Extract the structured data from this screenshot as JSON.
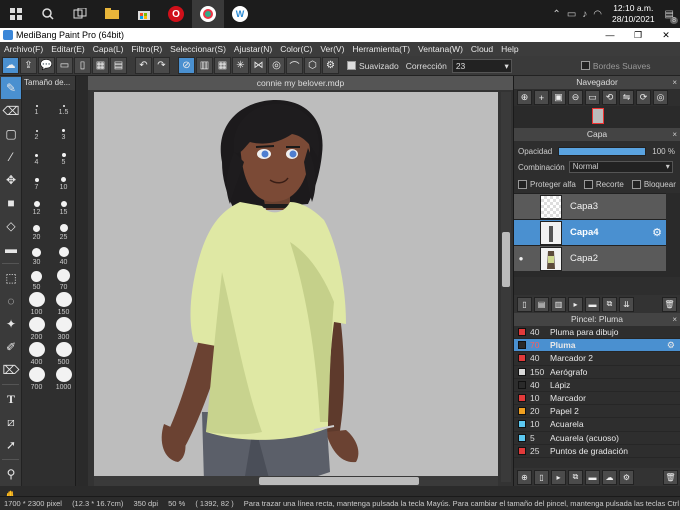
{
  "taskbar": {
    "apps": [
      {
        "icon": "windows-icon"
      },
      {
        "icon": "search-icon"
      },
      {
        "icon": "task-view-icon"
      },
      {
        "icon": "file-explorer-icon"
      },
      {
        "icon": "store-icon"
      },
      {
        "icon": "opera-icon"
      },
      {
        "icon": "medibang-icon"
      },
      {
        "icon": "webex-icon"
      }
    ],
    "time": "12:10 a.m.",
    "date": "28/10/2021",
    "notifications": "8"
  },
  "window": {
    "title": "MediBang Paint Pro (64bit)"
  },
  "menu": [
    "Archivo(F)",
    "Editar(E)",
    "Capa(L)",
    "Filtro(R)",
    "Seleccionar(S)",
    "Ajustar(N)",
    "Color(C)",
    "Ver(V)",
    "Herramienta(T)",
    "Ventana(W)",
    "Cloud",
    "Help"
  ],
  "toolbar": {
    "antialias_label": "Suavizado",
    "correction_label": "Corrección",
    "correction_value": "23",
    "soft_edges_label": "Bordes Suaves"
  },
  "brush_size": {
    "title": "Tamaño de...",
    "sizes": [
      "1",
      "1.5",
      "2",
      "3",
      "4",
      "5",
      "7",
      "10",
      "12",
      "15",
      "20",
      "25",
      "30",
      "40",
      "50",
      "70",
      "100",
      "150",
      "200",
      "300",
      "400",
      "500",
      "700",
      "1000"
    ]
  },
  "document": {
    "tab": "connie my belover.mdp"
  },
  "navigator": {
    "title": "Navegador"
  },
  "layers": {
    "title": "Capa",
    "opacity_label": "Opacidad",
    "opacity_value": "100 %",
    "opacity": 1.0,
    "blend_label": "Combinación",
    "blend_value": "Normal",
    "protect_alpha": "Proteger alfa",
    "clip": "Recorte",
    "lock": "Bloquear",
    "items": [
      {
        "name": "Capa3",
        "visible": false
      },
      {
        "name": "Capa4",
        "visible": false,
        "selected": true
      },
      {
        "name": "Capa2",
        "visible": true
      }
    ]
  },
  "brushes": {
    "title": "Pincel: Pluma",
    "items": [
      {
        "size": "40",
        "name": "Pluma para dibujo",
        "color": "#e23a3a"
      },
      {
        "size": "70",
        "name": "Pluma",
        "color": "#2a2a2a",
        "selected": true
      },
      {
        "size": "40",
        "name": "Marcador 2",
        "color": "#e23a3a"
      },
      {
        "size": "150",
        "name": "Aerógrafo",
        "color": "#d8d8d8"
      },
      {
        "size": "40",
        "name": "Lápiz",
        "color": "#2a2a2a"
      },
      {
        "size": "10",
        "name": "Marcador",
        "color": "#e23a3a"
      },
      {
        "size": "20",
        "name": "Papel 2",
        "color": "#f0a020"
      },
      {
        "size": "10",
        "name": "Acuarela",
        "color": "#5cc8f0"
      },
      {
        "size": "5",
        "name": "Acuarela (acuoso)",
        "color": "#5cc8f0"
      },
      {
        "size": "25",
        "name": "Puntos de gradación",
        "color": "#e23a3a"
      }
    ]
  },
  "status": {
    "size": "1700 * 2300 pixel",
    "cm": "(12.3 * 16.7cm)",
    "dpi": "350 dpi",
    "zoom": "50 %",
    "coords": "( 1392, 82 )",
    "hint": "Para trazar una línea recta, mantenga pulsada la tecla Mayús. Para cambiar el tamaño del pincel, mantenga pulsada las teclas Ctrl"
  },
  "colors": {
    "accent": "#4a90d0",
    "panel": "#2e2e2e",
    "canvas_bg": "#bdbdbd"
  }
}
